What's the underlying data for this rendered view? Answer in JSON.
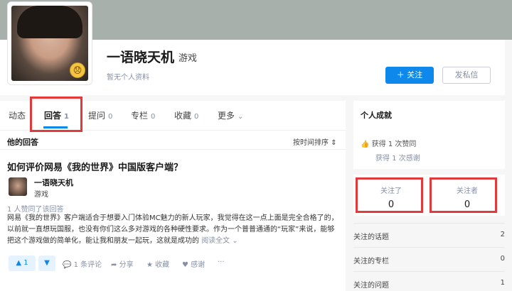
{
  "profile": {
    "name": "一语晓天机",
    "tag": "游戏",
    "bio": "暂无个人资料",
    "follow_button": "＋ 关注",
    "message_button": "发私信",
    "avatar_emoji": "😞"
  },
  "tabs": [
    {
      "label": "动态",
      "count": ""
    },
    {
      "label": "回答",
      "count": "1"
    },
    {
      "label": "提问",
      "count": "0"
    },
    {
      "label": "专栏",
      "count": "0"
    },
    {
      "label": "收藏",
      "count": "0"
    },
    {
      "label": "更多",
      "count": ""
    }
  ],
  "answers": {
    "heading": "他的回答",
    "sort_label": "按时间排序",
    "item": {
      "question": "如何评价网易《我的世界》中国版客户端？",
      "author_name": "一语晓天机",
      "author_tag": "游戏",
      "votes_text": "1 人赞同了该回答",
      "excerpt": "网易《我的世界》客户端适合于想要入门体验MC魅力的新人玩家，我觉得在这一点上面是完全合格了的，以前就一直想玩国服，也没有你们这么多对游戏的各种硬性要求。作为一个普普通通的“玩家”来说，能够把这个游戏做的简单化，能让我和朋友一起玩，这就是成功的",
      "read_more": "阅读全文 ⌄",
      "vote_up": "▲ 1",
      "vote_down": "▼",
      "comment": "1 条评论",
      "share": "分享",
      "collect": "收藏",
      "thank": "感谢",
      "more": "···"
    }
  },
  "side": {
    "achievements_title": "个人成就",
    "likes": "获得 1 次赞同",
    "thanks": "获得 1 次感谢",
    "following_label": "关注了",
    "following_value": "0",
    "followers_label": "关注者",
    "followers_value": "0",
    "list": [
      {
        "label": "关注的话题",
        "value": "2"
      },
      {
        "label": "关注的专栏",
        "value": "0"
      },
      {
        "label": "关注的问题",
        "value": "1"
      }
    ]
  },
  "colors": {
    "accent": "#0f88eb",
    "highlight": "#e03a3a"
  }
}
